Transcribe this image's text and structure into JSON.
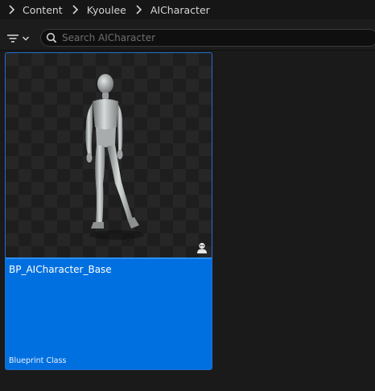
{
  "breadcrumb": {
    "items": [
      {
        "label": "Content"
      },
      {
        "label": "Kyoulee"
      },
      {
        "label": "AICharacter"
      }
    ]
  },
  "toolbar": {
    "filter_icon": "filter-icon",
    "search_icon": "search-icon",
    "search_placeholder": "Search AICharacter",
    "search_value": ""
  },
  "assets": [
    {
      "name": "BP_AICharacter_Base",
      "type": "Blueprint Class",
      "thumbnail": "humanoid-mannequin",
      "class_icon": "character-class-icon"
    }
  ],
  "colors": {
    "background": "#1a1a1a",
    "selection": "#0070e0",
    "selection_border": "#2d8cf0"
  }
}
